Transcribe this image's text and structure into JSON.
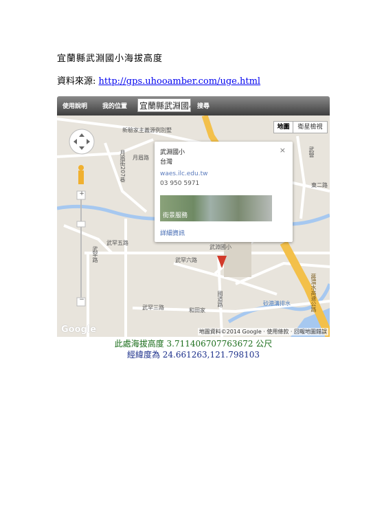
{
  "document": {
    "title": "宜蘭縣武淵國小海拔高度",
    "source_label": "資料來源: ",
    "source_link": "http://gps.uhooamber.com/uge.html"
  },
  "toolbar": {
    "help_label": "使用說明",
    "mylocation_label": "我的位置",
    "search_value": "宜蘭縣武淵國小",
    "search_label": "搜尋"
  },
  "map": {
    "map_type_map": "地圖",
    "map_type_satellite": "衛星檢視",
    "labels": {
      "station": "新驗家主義源例別墅",
      "yueming": "月眉路",
      "yueming_alley": "月眉街207巷",
      "wuyuan_road": "武罕五路",
      "wuyuan_six": "武罕六路",
      "wuyuan_three": "武罕三路",
      "wuyuan_west": "武罕路",
      "heitian": "和田家",
      "east2": "東二路",
      "expressway": "蔣渭水高速公路",
      "river": "砂港溝排水",
      "school_lane": "國道路",
      "east_road": "武營",
      "top_road": "蔣渭水高速公路",
      "school_tag": "武淵國小"
    },
    "footer": "地圖資料©2014 Google · 使用條款 · 回報地圖錯誤",
    "google": "Google"
  },
  "popup": {
    "name": "武淵國小",
    "country": "台灣",
    "website": "waes.ilc.edu.tw",
    "phone": "03 950 5971",
    "streetview_label": "街景服務",
    "details_label": "詳細資訊",
    "close": "×"
  },
  "result": {
    "elevation_text": "此處海拔高度 3.71140670776367​2 公尺",
    "coords_text": "經緯度為 24.661263,121.798103"
  },
  "colors": {
    "road_major": "#f3c04a",
    "water": "#a6c8f0",
    "land": "#e8e4dc",
    "marker": "#d23a2a"
  }
}
